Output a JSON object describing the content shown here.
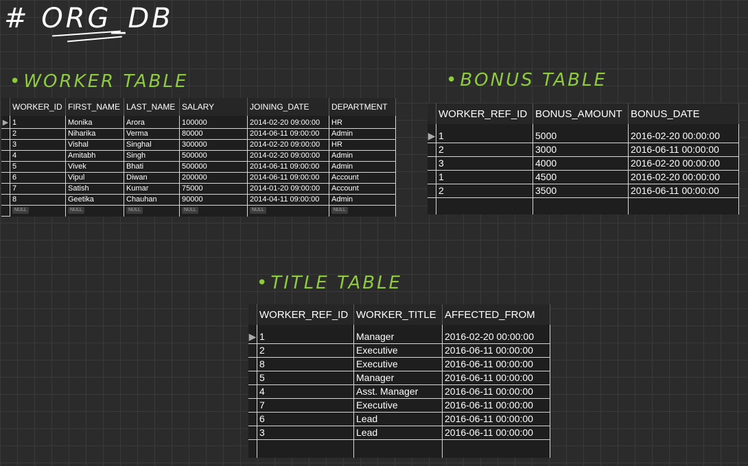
{
  "page_title": "# ORG_DB",
  "worker_section": {
    "heading": "WORKER TABLE",
    "columns": [
      "WORKER_ID",
      "FIRST_NAME",
      "LAST_NAME",
      "SALARY",
      "JOINING_DATE",
      "DEPARTMENT"
    ],
    "rows": [
      [
        "1",
        "Monika",
        "Arora",
        "100000",
        "2014-02-20 09:00:00",
        "HR"
      ],
      [
        "2",
        "Niharika",
        "Verma",
        "80000",
        "2014-06-11 09:00:00",
        "Admin"
      ],
      [
        "3",
        "Vishal",
        "Singhal",
        "300000",
        "2014-02-20 09:00:00",
        "HR"
      ],
      [
        "4",
        "Amitabh",
        "Singh",
        "500000",
        "2014-02-20 09:00:00",
        "Admin"
      ],
      [
        "5",
        "Vivek",
        "Bhati",
        "500000",
        "2014-06-11 09:00:00",
        "Admin"
      ],
      [
        "6",
        "Vipul",
        "Diwan",
        "200000",
        "2014-06-11 09:00:00",
        "Account"
      ],
      [
        "7",
        "Satish",
        "Kumar",
        "75000",
        "2014-01-20 09:00:00",
        "Account"
      ],
      [
        "8",
        "Geetika",
        "Chauhan",
        "90000",
        "2014-04-11 09:00:00",
        "Admin"
      ]
    ],
    "null_label": "NULL",
    "row_marker": "▶"
  },
  "bonus_section": {
    "heading": "BONUS TABLE",
    "columns": [
      "WORKER_REF_ID",
      "BONUS_AMOUNT",
      "BONUS_DATE"
    ],
    "rows": [
      [
        "1",
        "5000",
        "2016-02-20 00:00:00"
      ],
      [
        "2",
        "3000",
        "2016-06-11 00:00:00"
      ],
      [
        "3",
        "4000",
        "2016-02-20 00:00:00"
      ],
      [
        "1",
        "4500",
        "2016-02-20 00:00:00"
      ],
      [
        "2",
        "3500",
        "2016-06-11 00:00:00"
      ]
    ],
    "row_marker": "▶"
  },
  "title_section": {
    "heading": "TITLE TABLE",
    "columns": [
      "WORKER_REF_ID",
      "WORKER_TITLE",
      "AFFECTED_FROM"
    ],
    "rows": [
      [
        "1",
        "Manager",
        "2016-02-20 00:00:00"
      ],
      [
        "2",
        "Executive",
        "2016-06-11 00:00:00"
      ],
      [
        "8",
        "Executive",
        "2016-06-11 00:00:00"
      ],
      [
        "5",
        "Manager",
        "2016-06-11 00:00:00"
      ],
      [
        "4",
        "Asst. Manager",
        "2016-06-11 00:00:00"
      ],
      [
        "7",
        "Executive",
        "2016-06-11 00:00:00"
      ],
      [
        "6",
        "Lead",
        "2016-06-11 00:00:00"
      ],
      [
        "3",
        "Lead",
        "2016-06-11 00:00:00"
      ]
    ],
    "row_marker": "▶"
  },
  "colors": {
    "background": "#2b2b2b",
    "grid": "#3a3a3a",
    "heading_green": "#8ecb3e",
    "table_bg": "#1e1e1e",
    "text": "#ffffff"
  }
}
